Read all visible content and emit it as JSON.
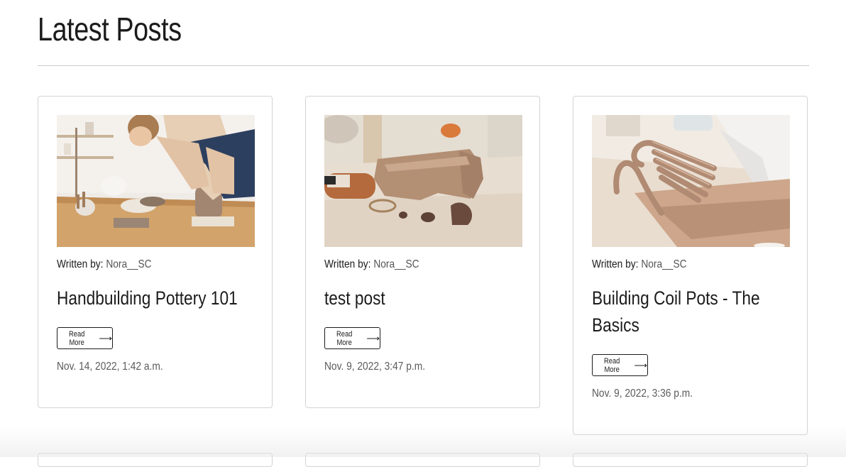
{
  "page": {
    "title": "Latest Posts"
  },
  "posts": [
    {
      "byline_label": "Written by:",
      "author": "Nora__SC",
      "title": "Handbuilding Pottery 101",
      "read_more": "Read More",
      "date": "Nov. 14, 2022, 1:42 a.m.",
      "image": "woman-shaping-clay-pot-photo"
    },
    {
      "byline_label": "Written by:",
      "author": "Nora__SC",
      "title": "test post",
      "read_more": "Read More",
      "date": "Nov. 9, 2022, 3:47 p.m.",
      "image": "clay-block-and-tools-photo"
    },
    {
      "byline_label": "Written by:",
      "author": "Nora__SC",
      "title": "Building Coil Pots - The Basics",
      "read_more": "Read More",
      "date": "Nov. 9, 2022, 3:36 p.m.",
      "image": "clay-coils-photo"
    }
  ],
  "icons": {
    "read_more_arrow": "arrow-right-icon"
  },
  "colors": {
    "text": "#1b1b1b",
    "muted": "#5a5a5a",
    "border": "#d3d3d3",
    "clay": "#b8957a"
  }
}
